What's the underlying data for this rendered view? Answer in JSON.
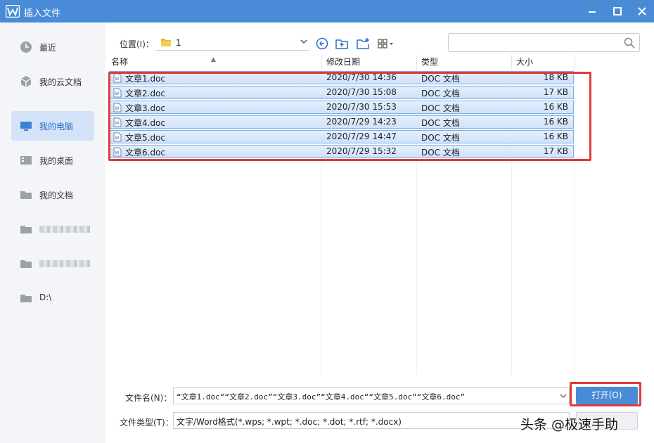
{
  "window": {
    "title": "插入文件"
  },
  "sidebar": {
    "items": [
      {
        "label": "最近",
        "icon": "clock-icon"
      },
      {
        "label": "我的云文档",
        "icon": "cloud-cube-icon"
      },
      {
        "label": "我的电脑",
        "icon": "monitor-icon",
        "active": true
      },
      {
        "label": "我的桌面",
        "icon": "desktop-icon"
      },
      {
        "label": "我的文档",
        "icon": "folder-icon"
      },
      {
        "label": "",
        "icon": "folder-icon",
        "blurred": true
      },
      {
        "label": "",
        "icon": "folder-icon",
        "blurred": true
      },
      {
        "label": "D:\\",
        "icon": "folder-icon"
      }
    ]
  },
  "toolbar": {
    "location_label": "位置(I)：",
    "path": "1",
    "search_placeholder": ""
  },
  "file_list": {
    "columns": [
      "名称",
      "修改日期",
      "类型",
      "大小"
    ],
    "rows": [
      {
        "name": "文章1.doc",
        "date": "2020/7/30 14:36",
        "type": "DOC 文档",
        "size": "18 KB"
      },
      {
        "name": "文章2.doc",
        "date": "2020/7/30 15:08",
        "type": "DOC 文档",
        "size": "17 KB"
      },
      {
        "name": "文章3.doc",
        "date": "2020/7/30 15:53",
        "type": "DOC 文档",
        "size": "16 KB"
      },
      {
        "name": "文章4.doc",
        "date": "2020/7/29 14:23",
        "type": "DOC 文档",
        "size": "16 KB"
      },
      {
        "name": "文章5.doc",
        "date": "2020/7/29 14:47",
        "type": "DOC 文档",
        "size": "16 KB"
      },
      {
        "name": "文章6.doc",
        "date": "2020/7/29 15:32",
        "type": "DOC 文档",
        "size": "17 KB"
      }
    ]
  },
  "bottom": {
    "filename_label": "文件名(N)：",
    "filename_value": "“文章1.doc”“文章2.doc”“文章3.doc”“文章4.doc”“文章5.doc”“文章6.doc”",
    "filetype_label": "文件类型(T)：",
    "filetype_value": "文字/Word格式(*.wps; *.wpt; *.doc; *.dot; *.rtf; *.docx)",
    "open_button": "打开(O)"
  },
  "watermark": "头条 @极速手助",
  "colors": {
    "accent": "#4a8bd8",
    "highlight": "#e03a3a",
    "selection": "#cfe2fa"
  }
}
